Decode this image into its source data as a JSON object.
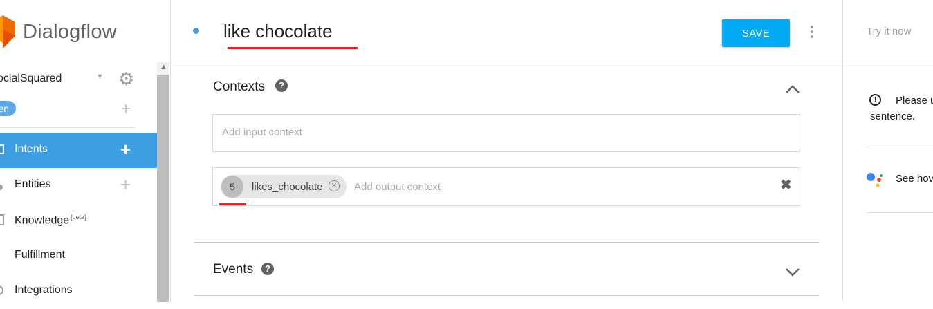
{
  "app": {
    "name": "Dialogflow"
  },
  "agent": {
    "name": "ocialSquared",
    "language": "en"
  },
  "sidebar": {
    "items": [
      {
        "label": "Intents",
        "active": true
      },
      {
        "label": "Entities"
      },
      {
        "label": "Knowledge",
        "badge": "[beta]"
      },
      {
        "label": "Fulfillment"
      },
      {
        "label": "Integrations"
      }
    ]
  },
  "header": {
    "title": "like chocolate",
    "save_label": "SAVE"
  },
  "contexts": {
    "title": "Contexts",
    "input_placeholder": "Add input context",
    "output_placeholder": "Add output context",
    "output_contexts": [
      {
        "lifespan": "5",
        "name": "likes_chocolate"
      }
    ]
  },
  "events": {
    "title": "Events"
  },
  "right_panel": {
    "try_label": "Try it now",
    "hint_line1": "Please u",
    "hint_line2": "sentence.",
    "see_how": "See hov"
  },
  "colors": {
    "accent": "#03a9f4",
    "nav_active": "#3e9ee2",
    "annotation_red": "#d8262a"
  },
  "icons": {
    "logo": "dialogflow-logo-icon",
    "settings": "gear-icon",
    "help": "help-circle-icon",
    "collapse": "chevron-up-icon",
    "expand": "chevron-down-icon",
    "clear": "close-icon",
    "info": "info-icon",
    "assistant": "google-assistant-icon"
  }
}
